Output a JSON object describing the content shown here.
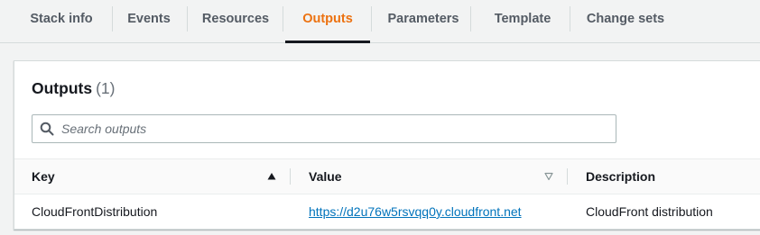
{
  "tabs": [
    {
      "label": "Stack info",
      "active": false
    },
    {
      "label": "Events",
      "active": false
    },
    {
      "label": "Resources",
      "active": false
    },
    {
      "label": "Outputs",
      "active": true
    },
    {
      "label": "Parameters",
      "active": false
    },
    {
      "label": "Template",
      "active": false
    },
    {
      "label": "Change sets",
      "active": false
    }
  ],
  "outputs": {
    "title": "Outputs",
    "count": "(1)",
    "search": {
      "placeholder": "Search outputs",
      "value": ""
    },
    "columns": {
      "key": "Key",
      "value": "Value",
      "description": "Description"
    },
    "rows": [
      {
        "key": "CloudFrontDistribution",
        "value": "https://d2u76w5rsvqq0y.cloudfront.net",
        "description": "CloudFront distribution"
      }
    ]
  },
  "colors": {
    "accent": "#ec7211",
    "link": "#0073bb",
    "text": "#16191f"
  },
  "icons": {
    "search": "search-icon",
    "sort_asc": "sort-ascending-icon",
    "sort_none": "sort-descending-outline-icon"
  }
}
